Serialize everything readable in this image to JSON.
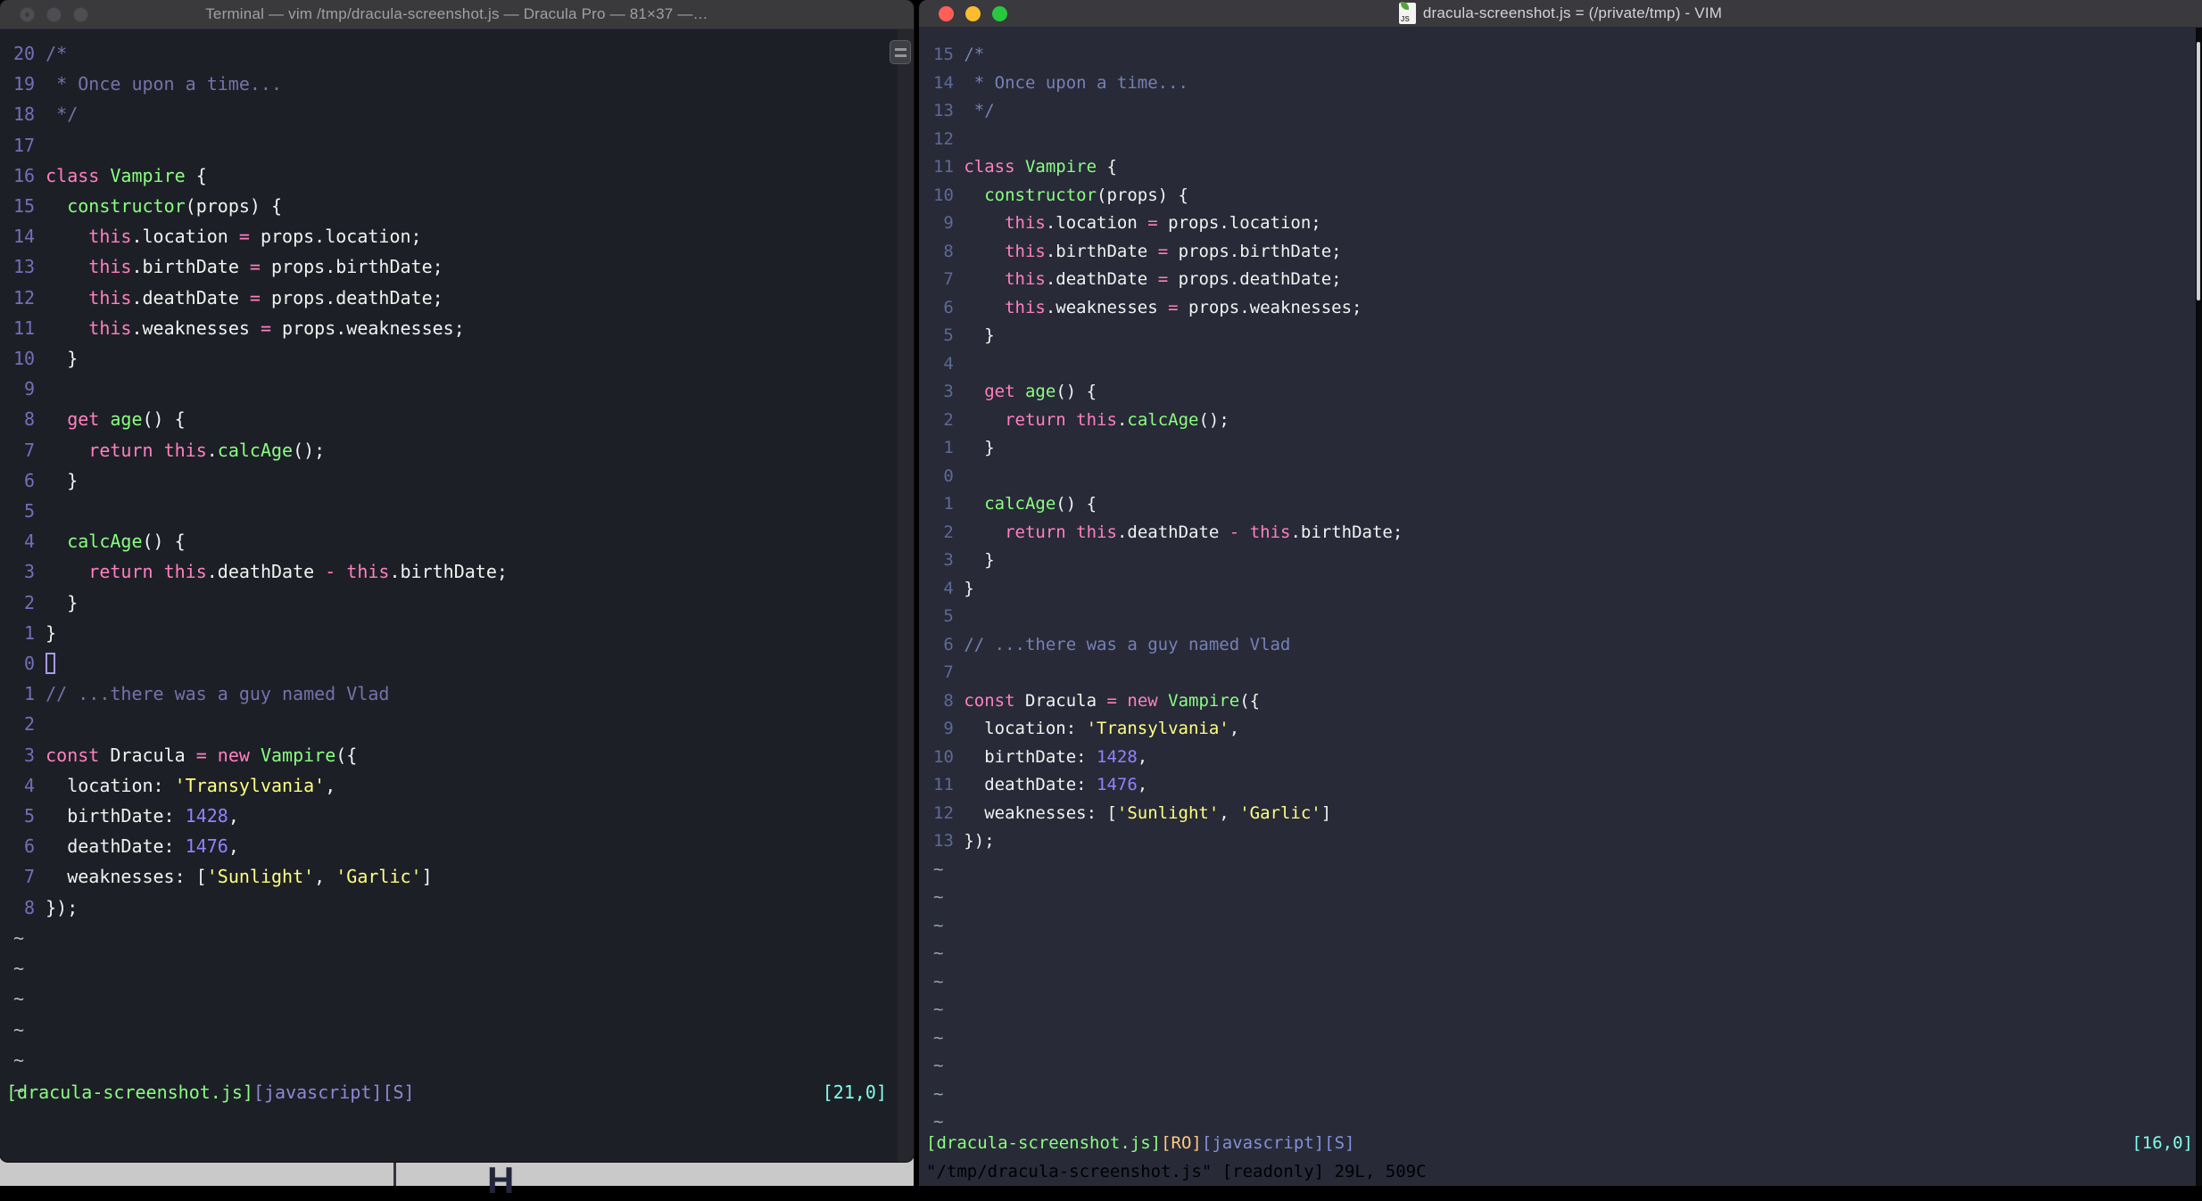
{
  "code_lines": [
    [
      [
        "comment",
        "/*"
      ]
    ],
    [
      [
        "comment",
        " * Once upon a time..."
      ]
    ],
    [
      [
        "comment",
        " */"
      ]
    ],
    [],
    [
      [
        "pink",
        "class"
      ],
      [
        "fg",
        " "
      ],
      [
        "green",
        "Vampire"
      ],
      [
        "fg",
        " {"
      ]
    ],
    [
      [
        "fg",
        "  "
      ],
      [
        "green",
        "constructor"
      ],
      [
        "fg",
        "(props) {"
      ]
    ],
    [
      [
        "fg",
        "    "
      ],
      [
        "pink",
        "this"
      ],
      [
        "fg",
        ".location "
      ],
      [
        "pink",
        "="
      ],
      [
        "fg",
        " props.location;"
      ]
    ],
    [
      [
        "fg",
        "    "
      ],
      [
        "pink",
        "this"
      ],
      [
        "fg",
        ".birthDate "
      ],
      [
        "pink",
        "="
      ],
      [
        "fg",
        " props.birthDate;"
      ]
    ],
    [
      [
        "fg",
        "    "
      ],
      [
        "pink",
        "this"
      ],
      [
        "fg",
        ".deathDate "
      ],
      [
        "pink",
        "="
      ],
      [
        "fg",
        " props.deathDate;"
      ]
    ],
    [
      [
        "fg",
        "    "
      ],
      [
        "pink",
        "this"
      ],
      [
        "fg",
        ".weaknesses "
      ],
      [
        "pink",
        "="
      ],
      [
        "fg",
        " props.weaknesses;"
      ]
    ],
    [
      [
        "fg",
        "  }"
      ]
    ],
    [],
    [
      [
        "fg",
        "  "
      ],
      [
        "pink",
        "get"
      ],
      [
        "fg",
        " "
      ],
      [
        "green",
        "age"
      ],
      [
        "fg",
        "() {"
      ]
    ],
    [
      [
        "fg",
        "    "
      ],
      [
        "pink",
        "return"
      ],
      [
        "fg",
        " "
      ],
      [
        "pink",
        "this"
      ],
      [
        "fg",
        "."
      ],
      [
        "green",
        "calcAge"
      ],
      [
        "fg",
        "();"
      ]
    ],
    [
      [
        "fg",
        "  }"
      ]
    ],
    [],
    [
      [
        "fg",
        "  "
      ],
      [
        "green",
        "calcAge"
      ],
      [
        "fg",
        "() {"
      ]
    ],
    [
      [
        "fg",
        "    "
      ],
      [
        "pink",
        "return"
      ],
      [
        "fg",
        " "
      ],
      [
        "pink",
        "this"
      ],
      [
        "fg",
        ".deathDate "
      ],
      [
        "pink",
        "-"
      ],
      [
        "fg",
        " "
      ],
      [
        "pink",
        "this"
      ],
      [
        "fg",
        ".birthDate;"
      ]
    ],
    [
      [
        "fg",
        "  }"
      ]
    ],
    [
      [
        "fg",
        "}"
      ]
    ],
    [],
    [
      [
        "comment",
        "// ...there was a guy named Vlad"
      ]
    ],
    [],
    [
      [
        "pink",
        "const"
      ],
      [
        "fg",
        " Dracula "
      ],
      [
        "pink",
        "="
      ],
      [
        "fg",
        " "
      ],
      [
        "pink",
        "new"
      ],
      [
        "fg",
        " "
      ],
      [
        "green",
        "Vampire"
      ],
      [
        "fg",
        "({"
      ]
    ],
    [
      [
        "fg",
        "  location: "
      ],
      [
        "yellow",
        "'Transylvania'"
      ],
      [
        "fg",
        ","
      ]
    ],
    [
      [
        "fg",
        "  birthDate: "
      ],
      [
        "purple",
        "1428"
      ],
      [
        "fg",
        ","
      ]
    ],
    [
      [
        "fg",
        "  deathDate: "
      ],
      [
        "purple",
        "1476"
      ],
      [
        "fg",
        ","
      ]
    ],
    [
      [
        "fg",
        "  weaknesses: ["
      ],
      [
        "yellow",
        "'Sunlight'"
      ],
      [
        "fg",
        ", "
      ],
      [
        "yellow",
        "'Garlic'"
      ],
      [
        "fg",
        "]"
      ]
    ],
    [
      [
        "fg",
        "});"
      ]
    ]
  ],
  "left_window": {
    "titlebar": {
      "title": "Terminal — vim /tmp/dracula-screenshot.js — Dracula Pro — 81×37 —…"
    },
    "palette": {
      "bg": "#1d1f27",
      "fg": "#f2f2f0",
      "pink": "#ff80bf",
      "green": "#8aff80",
      "yellow": "#ffff80",
      "purple": "#9580ff",
      "comment": "#7970a9",
      "number": "#766eb8",
      "tilde": "#b6bac3",
      "cursor": "#a89aec"
    },
    "line_numbers": [
      "20",
      "19",
      "18",
      "17",
      "16",
      "15",
      "14",
      "13",
      "12",
      "11",
      "10",
      "9",
      "8",
      "7",
      "6",
      "5",
      "4",
      "3",
      "2",
      "1",
      "0",
      "1",
      "2",
      "3",
      "4",
      "5",
      "6",
      "7",
      "8"
    ],
    "cursor_line_index": 20,
    "tilde_char": "~",
    "tilde_count": 6,
    "statusline": {
      "segments": [
        {
          "text": "[dracula-screenshot.js]",
          "color": "#8aff80"
        },
        {
          "text": "[javascript][S]",
          "color": "#9087d6"
        }
      ],
      "position": "[21,0]",
      "position_color": "#80ffea"
    }
  },
  "right_window": {
    "titlebar": {
      "title": "dracula-screenshot.js = (/private/tmp) - VIM",
      "icon": "js-document-icon",
      "icon_label": "JS"
    },
    "palette": {
      "bg": "#282a38",
      "fg": "#f2f2f0",
      "pink": "#ff80bf",
      "green": "#8aff80",
      "yellow": "#ffff80",
      "purple": "#9580ff",
      "comment": "#7681b5",
      "number": "#5d6a95",
      "tilde": "#9aa2b5"
    },
    "line_numbers": [
      "15",
      "14",
      "13",
      "12",
      "11",
      "10",
      "9",
      "8",
      "7",
      "6",
      "5",
      "4",
      "3",
      "2",
      "1",
      "0",
      "1",
      "2",
      "3",
      "4",
      "5",
      "6",
      "7",
      "8",
      "9",
      "10",
      "11",
      "12",
      "13"
    ],
    "cursor_line_index": null,
    "tilde_char": "~",
    "tilde_count": 10,
    "statusline": {
      "segments": [
        {
          "text": "[dracula-screenshot.js]",
          "color": "#8aff80"
        },
        {
          "text": "[RO]",
          "color": "#ffca80"
        },
        {
          "text": "[javascript][S]",
          "color": "#8290d8"
        }
      ],
      "position": "[16,0]",
      "position_color": "#80ffea"
    },
    "command_line": "\"/tmp/dracula-screenshot.js\" [readonly] 29L, 509C"
  },
  "background_window": {
    "visible_text": "H"
  }
}
